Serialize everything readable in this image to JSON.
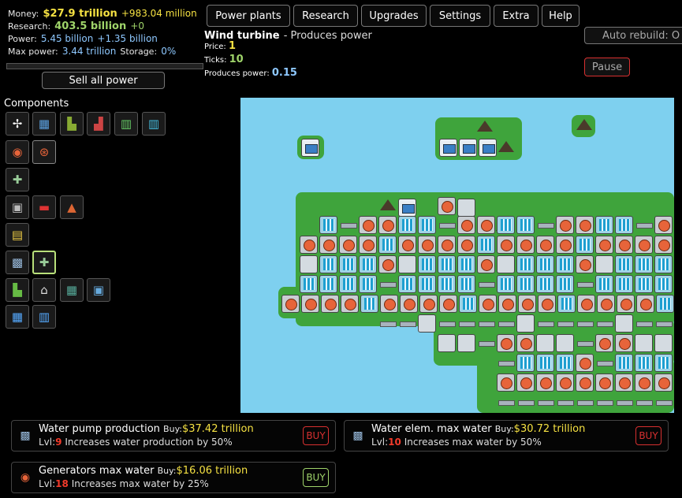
{
  "stats": {
    "money_label": "Money:",
    "money_value": "$27.9 trillion",
    "money_income": "+983.04 million",
    "research_label": "Research:",
    "research_value": "403.5 billion",
    "research_income": "+0",
    "power_label": "Power:",
    "power_value": "5.45 billion",
    "power_income": "+1.35 billion",
    "maxpower_label": "Max power:",
    "maxpower_value": "3.44 trillion",
    "storage_label": "Storage:",
    "storage_value": "0%",
    "storage_fraction": 0.0
  },
  "sell_button": "Sell all power",
  "tabs": [
    "Power plants",
    "Research",
    "Upgrades",
    "Settings",
    "Extra",
    "Help"
  ],
  "info": {
    "title": "Wind turbine",
    "desc": "- Produces power",
    "price_label": "Price:",
    "price": "1",
    "ticks_label": "Ticks:",
    "ticks": "10",
    "produces_label": "Produces power:",
    "produces": "0.15"
  },
  "auto_rebuild": "Auto rebuild: O",
  "pause_button": "Pause",
  "components_label": "Components",
  "components": {
    "row1": [
      "wind-turbine-icon",
      "solar-panel-icon",
      "coal-plant-icon",
      "nuclear-plant-icon",
      "water-cell-icon",
      "water-cell-large-icon"
    ],
    "row2": [
      "generator-icon",
      "generator-large-icon"
    ],
    "row3": [
      "pipe-junction-icon"
    ],
    "row4": [
      "battery-icon",
      "fuel-icon",
      "tank-icon"
    ],
    "row5": [
      "heat-sink-icon"
    ],
    "row6": [
      "water-pump-icon",
      "water-connector-icon"
    ],
    "row7": [
      "office-icon",
      "house-icon",
      "apartment-icon",
      "shop-icon"
    ],
    "row8": [
      "factory-icon",
      "bank-icon"
    ]
  },
  "upgrades": [
    {
      "name": "Water pump production",
      "buy_label": "Buy:",
      "price": "$37.42 trillion",
      "lvl_label": "Lvl:",
      "lvl": "9",
      "desc": "Increases water production by 50%",
      "button": "BUY",
      "affordable": false
    },
    {
      "name": "Water elem. max water",
      "buy_label": "Buy:",
      "price": "$30.72 trillion",
      "lvl_label": "Lvl:",
      "lvl": "10",
      "desc": "Increases max water by 50%",
      "button": "BUY",
      "affordable": false
    },
    {
      "name": "Generators max water",
      "buy_label": "Buy:",
      "price": "$16.06 trillion",
      "lvl_label": "Lvl:",
      "lvl": "18",
      "desc": "Increases max water by 25%",
      "button": "BUY",
      "affordable": true
    }
  ],
  "colors": {
    "money": "#f5e142",
    "research": "#9fd46a",
    "power": "#8ec8ff",
    "level": "#f23b2b",
    "water": "#7ed0ef",
    "land": "#3fa43c"
  }
}
